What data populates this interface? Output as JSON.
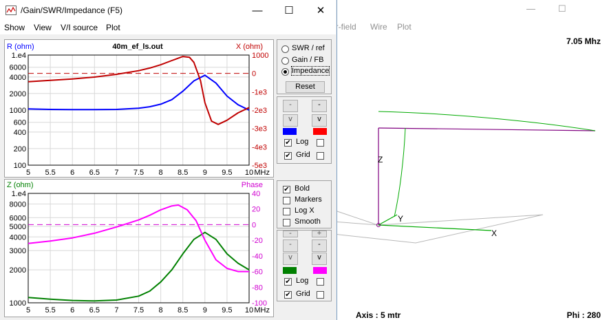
{
  "bg_window": {
    "menu": [
      "ar-field",
      "Wire",
      "Plot"
    ],
    "frequency": "7.05 Mhz",
    "axis_label": "Axis : 5 mtr",
    "phi_label": "Phi : 280",
    "axis_labels": {
      "z": "Z",
      "y": "Y",
      "x": "X"
    },
    "controls": {
      "minimize": "—",
      "maximize": "☐"
    }
  },
  "window": {
    "title": "/Gain/SWR/Impedance (F5)",
    "controls": {
      "minimize": "—",
      "maximize": "☐",
      "close": "✕"
    }
  },
  "menu": [
    "Show",
    "View",
    "V/I source",
    "Plot"
  ],
  "top_panel": {
    "radio": [
      "SWR / ref",
      "Gain / FB",
      "Impedance"
    ],
    "selected": "Impedance",
    "reset": "Reset",
    "buttons": [
      "-",
      "-",
      "v",
      "v"
    ],
    "colors": {
      "left": "#0000ff",
      "right": "#ff0000"
    },
    "log": "Log",
    "grid": "Grid",
    "log_checked": true,
    "grid_checked": true
  },
  "bottom_panel": {
    "options": [
      "Bold",
      "Markers",
      "Log X",
      "Smooth"
    ],
    "checked": [
      true,
      false,
      false,
      false
    ],
    "buttons": [
      "-",
      "+",
      "-",
      "-",
      "v",
      "v"
    ],
    "colors": {
      "left": "#008000",
      "right": "#ff00ff"
    },
    "log": "Log",
    "grid": "Grid",
    "log_checked": true,
    "grid_checked": true
  },
  "chart_data": [
    {
      "type": "line",
      "title": "40m_ef_ls.out",
      "ylabel": "R (ohm)",
      "y2label": "X (ohm)",
      "xlabel": "MHz",
      "x_ticks": [
        "5",
        "5.5",
        "6",
        "6.5",
        "7",
        "7.5",
        "8",
        "8.5",
        "9",
        "9.5",
        "10"
      ],
      "y_ticks": [
        "1.e4",
        "6000",
        "4000",
        "2000",
        "1000",
        "600",
        "400",
        "200",
        "100"
      ],
      "y2_ticks": [
        "1000",
        "0",
        "-1e3",
        "-2e3",
        "-3e3",
        "-4e3",
        "-5e3"
      ],
      "yscale": "log",
      "ylim": [
        100,
        10000
      ],
      "y2lim": [
        -5000,
        1000
      ],
      "xlim": [
        5,
        10
      ],
      "series": [
        {
          "name": "R (ohm)",
          "axis": "left",
          "color": "#0000ff",
          "x": [
            5,
            5.5,
            6,
            6.5,
            7,
            7.5,
            7.75,
            8,
            8.25,
            8.5,
            8.75,
            9,
            9.25,
            9.5,
            9.75,
            10
          ],
          "y": [
            1050,
            1030,
            1020,
            1020,
            1030,
            1080,
            1150,
            1280,
            1550,
            2200,
            3400,
            4300,
            3100,
            1800,
            1250,
            1000
          ]
        },
        {
          "name": "X (ohm)",
          "axis": "right",
          "color": "#c00000",
          "x": [
            5,
            5.5,
            6,
            6.5,
            7,
            7.5,
            7.75,
            8,
            8.25,
            8.5,
            8.65,
            8.75,
            8.9,
            9,
            9.15,
            9.3,
            9.5,
            9.75,
            10
          ],
          "y": [
            -450,
            -380,
            -300,
            -200,
            -50,
            150,
            290,
            470,
            700,
            920,
            880,
            600,
            -400,
            -1600,
            -2600,
            -2780,
            -2550,
            -2150,
            -1860
          ]
        }
      ],
      "reference_line": 0
    },
    {
      "type": "line",
      "ylabel": "Z (ohm)",
      "y2label": "Phase",
      "xlabel": "MHz",
      "x_ticks": [
        "5",
        "5.5",
        "6",
        "6.5",
        "7",
        "7.5",
        "8",
        "8.5",
        "9",
        "9.5",
        "10"
      ],
      "y_ticks": [
        "1.e4",
        "8000",
        "6000",
        "5000",
        "4000",
        "3000",
        "2000",
        "1000"
      ],
      "y2_ticks": [
        "40",
        "20",
        "0",
        "-20",
        "-40",
        "-60",
        "-80",
        "-100"
      ],
      "yscale": "log",
      "ylim": [
        1000,
        10000
      ],
      "y2lim": [
        -100,
        40
      ],
      "xlim": [
        5,
        10
      ],
      "series": [
        {
          "name": "Z (ohm)",
          "axis": "left",
          "color": "#008000",
          "x": [
            5,
            5.5,
            6,
            6.5,
            7,
            7.5,
            7.75,
            8,
            8.25,
            8.5,
            8.75,
            9,
            9.25,
            9.5,
            9.75,
            10
          ],
          "y": [
            1120,
            1080,
            1050,
            1040,
            1060,
            1150,
            1280,
            1550,
            2000,
            2800,
            3800,
            4400,
            3800,
            2800,
            2300,
            2000
          ]
        },
        {
          "name": "Phase",
          "axis": "right",
          "color": "#ff00ff",
          "x": [
            5,
            5.5,
            6,
            6.5,
            7,
            7.5,
            7.75,
            8,
            8.25,
            8.4,
            8.6,
            8.8,
            9,
            9.25,
            9.5,
            9.75,
            10
          ],
          "y": [
            -24,
            -21,
            -17,
            -11,
            -3,
            6,
            12,
            19,
            24,
            25,
            19,
            5,
            -20,
            -45,
            -56,
            -60,
            -60
          ]
        }
      ],
      "reference_line": 0
    }
  ]
}
